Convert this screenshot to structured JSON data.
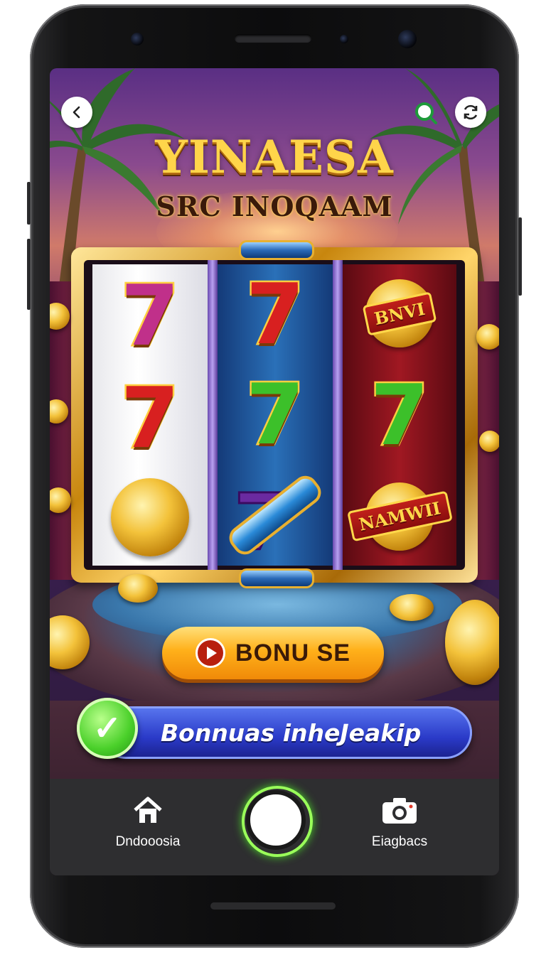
{
  "game": {
    "title": "YINAESA",
    "subtitle": "SRC INOQAAM"
  },
  "header": {
    "back_icon": "chevron-left-icon",
    "search_icon": "search-icon",
    "sync_icon": "sync-icon"
  },
  "reels": {
    "reel_1": [
      "7",
      "7",
      "coin"
    ],
    "reel_2": [
      "7",
      "7",
      "rocket"
    ],
    "reel_3": [
      "BNVI",
      "7",
      "NAMWII"
    ],
    "symbols": {
      "bnvi_label": "BNVI",
      "namwii_label": "NAMWII",
      "gem_glyph": "7"
    },
    "seven_glyph": "7"
  },
  "bonus_button": {
    "label": "BONU SE",
    "icon": "play-icon"
  },
  "banner": {
    "label": "Bonnuas inheJeakip",
    "icon": "check-icon"
  },
  "navbar": {
    "items": [
      {
        "label": "Dndooosia",
        "icon": "home-icon"
      },
      {
        "label": "Eiagbacs",
        "icon": "camera-icon"
      }
    ],
    "center_icon": "shutter-button"
  },
  "colors": {
    "gold": "#ffd54a",
    "bonus_orange": "#ffb01a",
    "banner_blue": "#2a3ac8",
    "check_green": "#4ad02a",
    "nav_bg": "#2e2e30"
  }
}
